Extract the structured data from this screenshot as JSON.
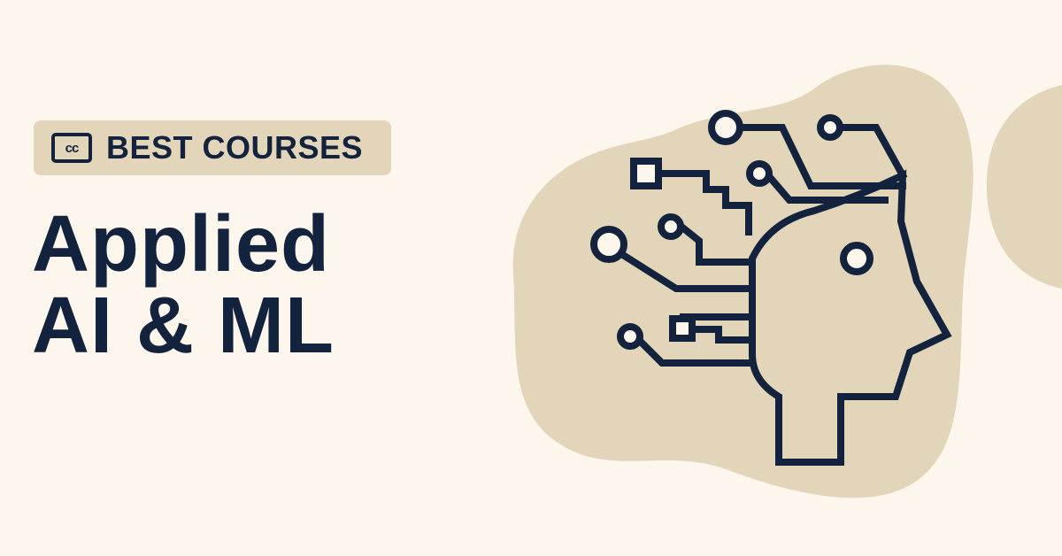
{
  "badge": {
    "icon_text": "cc",
    "label": "BEST COURSES"
  },
  "title": {
    "line1": "Applied",
    "line2": "AI & ML"
  },
  "colors": {
    "background": "#fdf6ec",
    "blob": "#e2d5ba",
    "ink": "#13233d"
  },
  "icons": {
    "logo": "cc-logo-icon",
    "illustration": "ai-brain-circuit-head-icon"
  }
}
